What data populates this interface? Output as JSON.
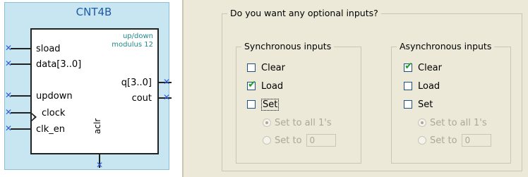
{
  "symbol": {
    "name": "CNT4B",
    "note_line1": "up/down",
    "note_line2": "modulus 12",
    "inputs": [
      "sload",
      "data[3..0]",
      "updown",
      "clock",
      "clk_en"
    ],
    "outputs": [
      "q[3..0]",
      "cout"
    ],
    "bottom_port": "aclr"
  },
  "options": {
    "question": "Do you want any optional inputs?",
    "synchronous": {
      "title": "Synchronous inputs",
      "clear": {
        "label": "Clear",
        "checked": false
      },
      "load": {
        "label": "Load",
        "checked": true
      },
      "set": {
        "label": "Set",
        "checked": false
      },
      "set_all_ones": "Set to all 1's",
      "set_to": "Set to",
      "set_to_value": "0"
    },
    "asynchronous": {
      "title": "Asynchronous inputs",
      "clear": {
        "label": "Clear",
        "checked": true
      },
      "load": {
        "label": "Load",
        "checked": false
      },
      "set": {
        "label": "Set",
        "checked": false
      },
      "set_all_ones": "Set to all 1's",
      "set_to": "Set to",
      "set_to_value": "0"
    }
  },
  "colors": {
    "symbol_bg": "#c7e6f1",
    "title": "#1f5aa6",
    "note": "#1f8a8a",
    "pin_marker": "#2f5bd8",
    "check": "#21a121"
  },
  "icons": {
    "check": "checkmark-icon",
    "pin": "x-marker-icon",
    "clock": "clock-triangle-icon"
  }
}
